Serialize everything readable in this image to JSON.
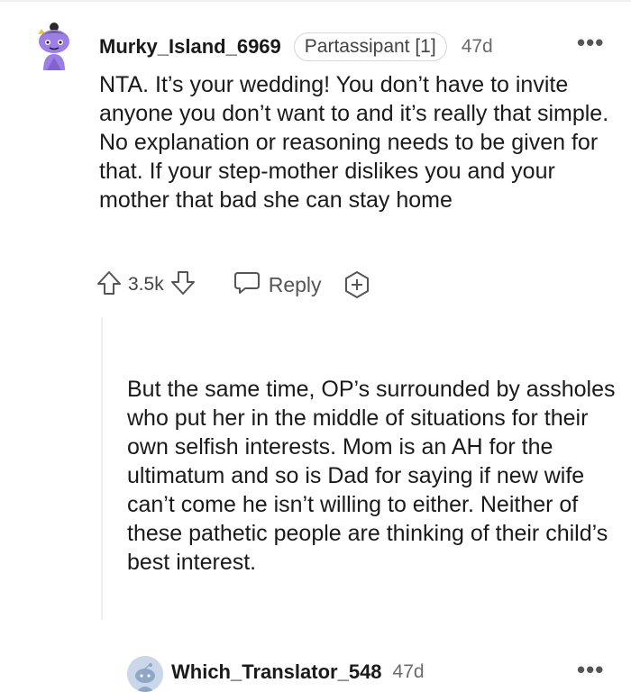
{
  "comments": [
    {
      "username": "Murky_Island_6969",
      "flair": "Partassipant [1]",
      "age": "47d",
      "text": "NTA. It’s your wedding! You don’t have to invite anyone you don’t want to and it’s really that simple. No explanation or reasoning needs to be given for that. If your step-mother dislikes you and your mother that bad she can stay home",
      "votes": "3.5k",
      "reply_label": "Reply",
      "avatar_icon": "snoo-avatar-purple-icon"
    },
    {
      "username": "Which_Translator_548",
      "age": "47d",
      "text": "But the same time, OP’s surrounded by assholes who put her in the middle of situations for their own selfish interests. Mom is an AH for the ultimatum and so is Dad for saying if new wife can’t come he isn’t willing to either. Neither of these pathetic people are thinking of their child’s best interest.",
      "avatar_icon": "snoo-avatar-default-icon"
    }
  ],
  "icons": {
    "more": "more-options-icon",
    "upvote": "upvote-arrow-icon",
    "downvote": "downvote-arrow-icon",
    "reply": "speech-bubble-icon",
    "award": "award-plus-icon"
  },
  "colors": {
    "avatar_purple": "#9b7fe6",
    "thread_line": "#edeff1",
    "meta_gray": "#6b6b6b"
  },
  "more_glyph": "•••"
}
